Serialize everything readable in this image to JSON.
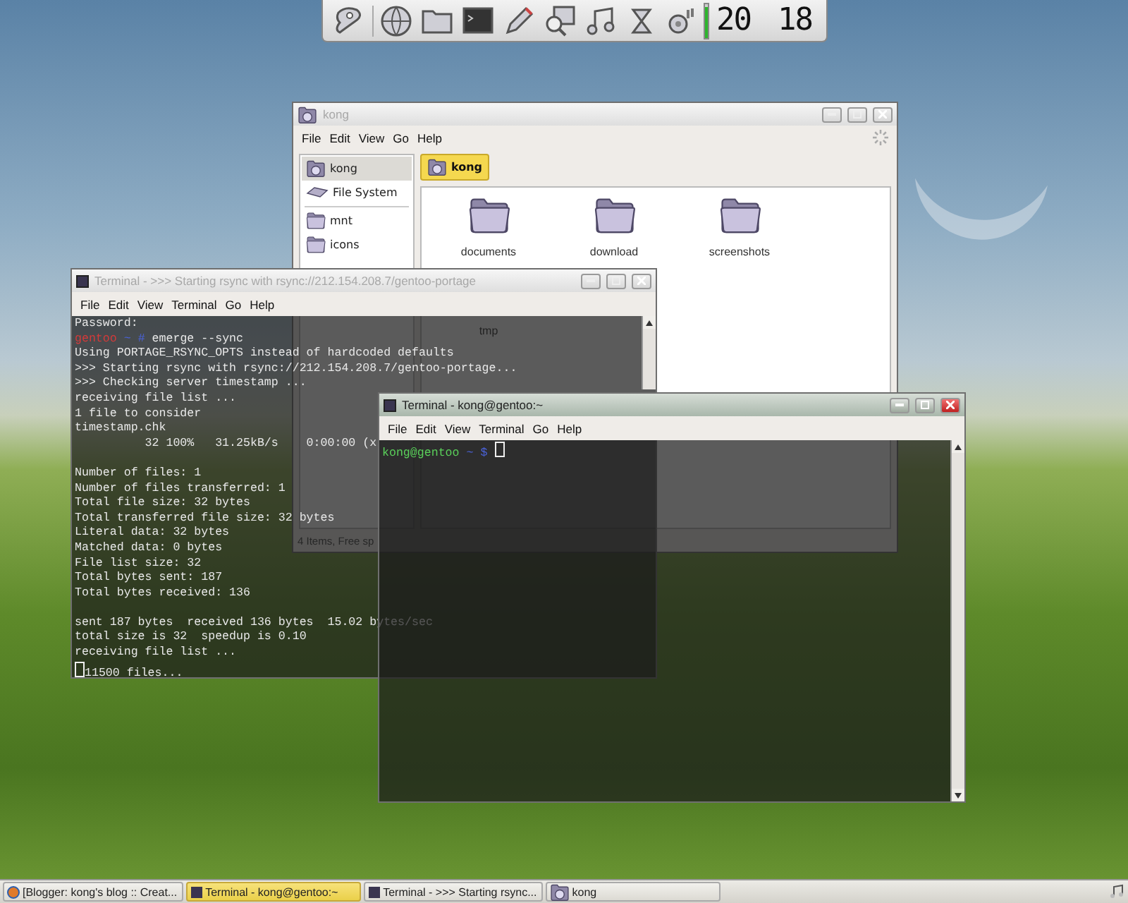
{
  "dock": {
    "volume": {
      "level": 0.9
    },
    "clock": {
      "hours": "20",
      "minutes": "18"
    }
  },
  "file_manager": {
    "title": "kong",
    "active": false,
    "menu": [
      "File",
      "Edit",
      "View",
      "Go",
      "Help"
    ],
    "places": [
      {
        "kind": "home",
        "label": "kong",
        "selected": true
      },
      {
        "kind": "drive",
        "label": "File System",
        "selected": false
      },
      {
        "kind": "folder",
        "label": "mnt",
        "selected": false
      },
      {
        "kind": "folder",
        "label": "icons",
        "selected": false
      }
    ],
    "location": "kong",
    "items": [
      {
        "label": "documents"
      },
      {
        "label": "download"
      },
      {
        "label": "screenshots"
      },
      {
        "label": "tmp"
      }
    ],
    "status": "4 Items, Free sp"
  },
  "terminals": [
    {
      "title": "Terminal - >>> Starting rsync with rsync://212.154.208.7/gentoo-portage",
      "active": false,
      "menu": [
        "File",
        "Edit",
        "View",
        "Terminal",
        "Go",
        "Help"
      ],
      "lines": [
        {
          "kind": "text",
          "text": "Password:"
        },
        {
          "kind": "root_prompt",
          "user": "gentoo",
          "path": "~",
          "symbol": "#",
          "command": "emerge --sync"
        },
        {
          "kind": "text",
          "text": "Using PORTAGE_RSYNC_OPTS instead of hardcoded defaults"
        },
        {
          "kind": "text",
          "text": ">>> Starting rsync with rsync://212.154.208.7/gentoo-portage..."
        },
        {
          "kind": "text",
          "text": ">>> Checking server timestamp ..."
        },
        {
          "kind": "text",
          "text": "receiving file list ..."
        },
        {
          "kind": "text",
          "text": "1 file to consider"
        },
        {
          "kind": "text",
          "text": "timestamp.chk"
        },
        {
          "kind": "text",
          "text": "          32 100%   31.25kB/s    0:00:00 (x"
        },
        {
          "kind": "blank"
        },
        {
          "kind": "text",
          "text": "Number of files: 1"
        },
        {
          "kind": "text",
          "text": "Number of files transferred: 1"
        },
        {
          "kind": "text",
          "text": "Total file size: 32 bytes"
        },
        {
          "kind": "text",
          "text": "Total transferred file size: 32 bytes"
        },
        {
          "kind": "text",
          "text": "Literal data: 32 bytes"
        },
        {
          "kind": "text",
          "text": "Matched data: 0 bytes"
        },
        {
          "kind": "text",
          "text": "File list size: 32"
        },
        {
          "kind": "text",
          "text": "Total bytes sent: 187"
        },
        {
          "kind": "text",
          "text": "Total bytes received: 136"
        },
        {
          "kind": "blank"
        },
        {
          "kind": "text",
          "text": "sent 187 bytes  received 136 bytes  15.02 bytes/sec"
        },
        {
          "kind": "text",
          "text": "total size is 32  speedup is 0.10"
        },
        {
          "kind": "text",
          "text": "receiving file list ..."
        },
        {
          "kind": "text",
          "text": "11500 files...",
          "cursor": true
        }
      ]
    },
    {
      "title": "Terminal - kong@gentoo:~",
      "active": true,
      "menu": [
        "File",
        "Edit",
        "View",
        "Terminal",
        "Go",
        "Help"
      ],
      "lines": [
        {
          "kind": "user_prompt",
          "user": "kong@gentoo",
          "path": "~",
          "symbol": "$",
          "cursor": true
        }
      ]
    }
  ],
  "taskbar": {
    "tasks": [
      {
        "kind": "browser",
        "label": "[Blogger: kong's blog :: Creat...",
        "selected": false
      },
      {
        "kind": "terminal",
        "label": "Terminal - kong@gentoo:~",
        "selected": true
      },
      {
        "kind": "terminal",
        "label": "Terminal - >>> Starting rsync...",
        "selected": false
      },
      {
        "kind": "files",
        "label": "kong",
        "selected": false
      }
    ]
  }
}
